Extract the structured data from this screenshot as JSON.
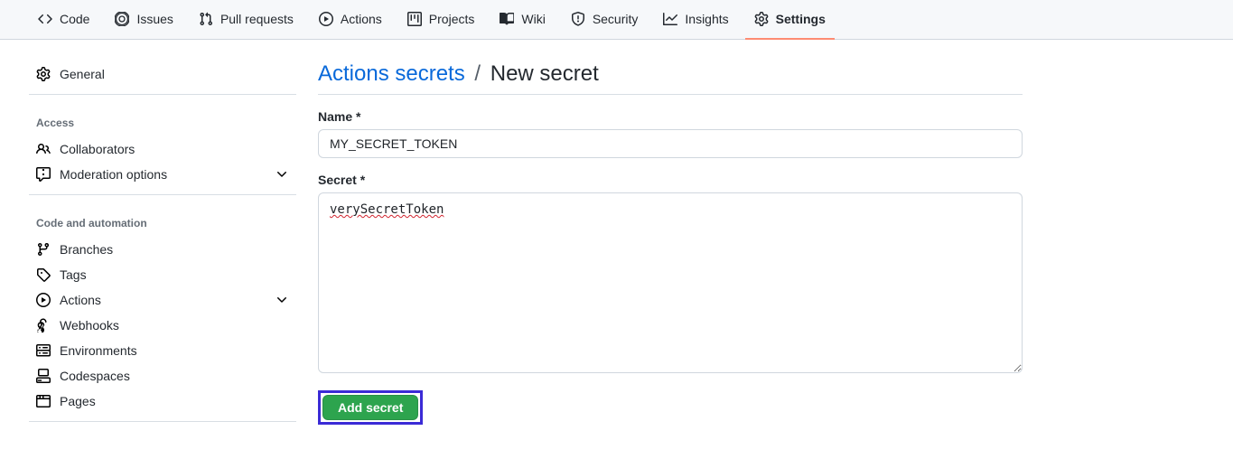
{
  "topnav": {
    "items": [
      {
        "label": "Code"
      },
      {
        "label": "Issues"
      },
      {
        "label": "Pull requests"
      },
      {
        "label": "Actions"
      },
      {
        "label": "Projects"
      },
      {
        "label": "Wiki"
      },
      {
        "label": "Security"
      },
      {
        "label": "Insights"
      },
      {
        "label": "Settings"
      }
    ]
  },
  "sidebar": {
    "general_label": "General",
    "access_header": "Access",
    "access_items": [
      {
        "label": "Collaborators"
      },
      {
        "label": "Moderation options"
      }
    ],
    "automation_header": "Code and automation",
    "automation_items": [
      {
        "label": "Branches"
      },
      {
        "label": "Tags"
      },
      {
        "label": "Actions"
      },
      {
        "label": "Webhooks"
      },
      {
        "label": "Environments"
      },
      {
        "label": "Codespaces"
      },
      {
        "label": "Pages"
      }
    ]
  },
  "main": {
    "breadcrumb_link": "Actions secrets",
    "breadcrumb_sep": "/",
    "breadcrumb_current": "New secret",
    "name_label": "Name *",
    "name_value": "MY_SECRET_TOKEN",
    "secret_label": "Secret *",
    "secret_value": "verySecretToken",
    "submit_label": "Add secret"
  }
}
